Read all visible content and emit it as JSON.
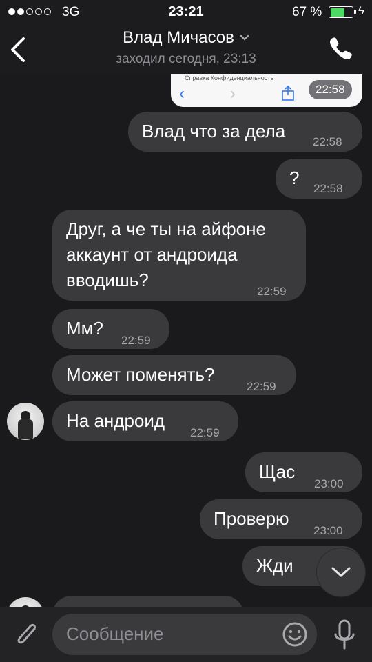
{
  "status_bar": {
    "network": "3G",
    "time": "23:21",
    "battery": "67 %",
    "battery_level": 0.67,
    "signal_bars": 2
  },
  "header": {
    "title": "Влад Мичасов",
    "subtitle": "заходил сегодня, 23:13",
    "icons": [
      "back-chevron",
      "chevron-down",
      "phone"
    ]
  },
  "screenshot_preview": {
    "menu_text": "Справка     Конфиденциальность",
    "time": "22:58"
  },
  "messages": [
    {
      "direction": "out",
      "text": "Влад что за дела",
      "time": "22:58"
    },
    {
      "direction": "out",
      "text": "?",
      "time": "22:58"
    },
    {
      "direction": "in",
      "lines": [
        "Друг, а че ты на айфоне",
        "аккаунт от андроида",
        "вводишь?"
      ],
      "time": "22:59"
    },
    {
      "direction": "in",
      "text": "Мм?",
      "time": "22:59"
    },
    {
      "direction": "in",
      "text": "Может поменять?",
      "time": "22:59"
    },
    {
      "direction": "in",
      "text": "На андроид",
      "time": "22:59"
    },
    {
      "direction": "out",
      "text": "Щас",
      "time": "23:00"
    },
    {
      "direction": "out",
      "text": "Проверю",
      "time": "23:00"
    },
    {
      "direction": "out",
      "text": "Жди",
      "time": ""
    }
  ],
  "input": {
    "placeholder": "Сообщение",
    "icons": [
      "paperclip",
      "smile",
      "microphone"
    ]
  },
  "colors": {
    "background": "#1a1a1c",
    "bubble": "#3a3a3c",
    "time_text": "#a8a8ad",
    "battery_green": "#4cd964"
  }
}
